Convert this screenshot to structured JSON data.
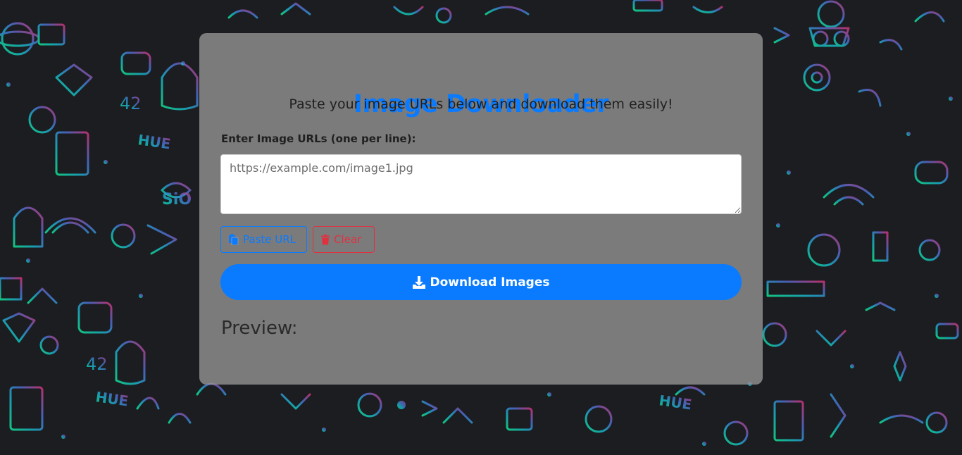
{
  "page": {
    "title": "Image Downloader",
    "subtitle": "Paste your image URLs below and download them easily!"
  },
  "form": {
    "label": "Enter Image URLs (one per line):",
    "placeholder": "https://example.com/image1.jpg",
    "value": ""
  },
  "buttons": {
    "paste_label": "Paste URL",
    "clear_label": "Clear",
    "download_label": "Download Images"
  },
  "preview": {
    "heading": "Preview:"
  },
  "icons": {
    "paste": "paste-icon",
    "clear": "trash-icon",
    "download": "download-icon"
  },
  "colors": {
    "accent": "#0a7bff",
    "danger": "#e0313f",
    "panel": "#969696",
    "background": "#1c1d21"
  }
}
